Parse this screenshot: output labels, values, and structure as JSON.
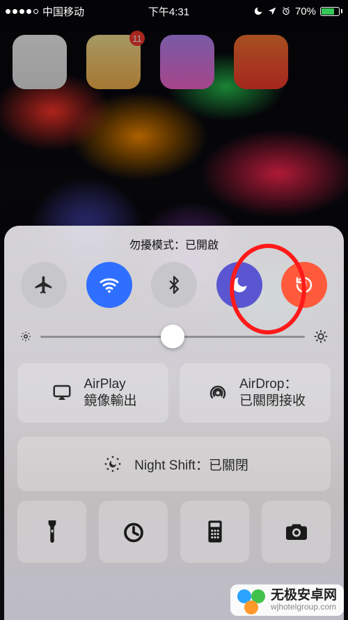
{
  "status_bar": {
    "carrier": "中国移动",
    "time": "下午4:31",
    "battery_percent": "70%",
    "battery_level": 0.7,
    "indicators": {
      "dnd": true,
      "location": true,
      "alarm": true
    }
  },
  "home": {
    "badges": {
      "weibo": "11"
    }
  },
  "control_center": {
    "caption": "勿擾模式：已開啟",
    "toggles": {
      "airplane": {
        "name": "airplane-icon",
        "active": false
      },
      "wifi": {
        "name": "wifi-icon",
        "active": true
      },
      "bluetooth": {
        "name": "bluetooth-icon",
        "active": false
      },
      "dnd": {
        "name": "moon-icon",
        "active": true
      },
      "lock": {
        "name": "rotation-lock-icon",
        "active": true
      }
    },
    "brightness": 0.5,
    "airplay": {
      "title": "AirPlay",
      "subtitle": "鏡像輸出"
    },
    "airdrop": {
      "title": "AirDrop：",
      "subtitle": "已關閉接收"
    },
    "night_shift": {
      "label": "Night Shift：已關閉"
    },
    "utilities": [
      "flashlight-icon",
      "timer-icon",
      "calculator-icon",
      "camera-icon"
    ]
  },
  "annotation": {
    "target": "dnd-toggle",
    "color": "#ff1a1a"
  },
  "watermark": {
    "name_cn": "无极安卓网",
    "url": "wjhotelgroup.com"
  }
}
